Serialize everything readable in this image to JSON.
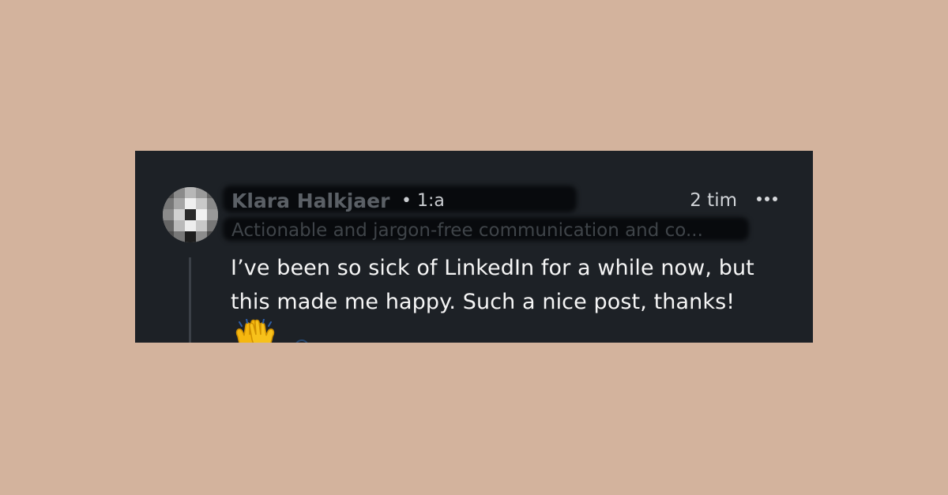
{
  "comment": {
    "author": "Klara Halkjaer",
    "degree": "• 1:a",
    "timestamp": "2 tim",
    "headline": "Actionable and jargon-free communication and co...",
    "text": "I’ve been so sick of LinkedIn for a while now, but this made me happy. Such a nice post, thanks!",
    "emoji": "raising-hands-emoji"
  },
  "icons": {
    "more": "more-options-icon",
    "avatar": "profile-avatar"
  },
  "colors": {
    "background": "#d3b39d",
    "card": "#1d2126",
    "text": "#f5f5f5",
    "muted": "#d0d3d7"
  }
}
